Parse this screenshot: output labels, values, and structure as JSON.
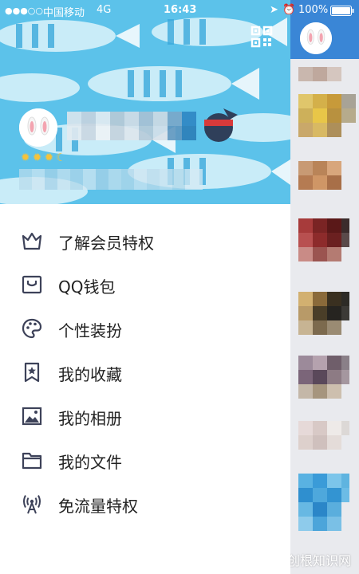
{
  "status_bar": {
    "signal": "●●●○○",
    "carrier": "中国移动",
    "network": "4G",
    "time": "16:43",
    "battery": "100%"
  },
  "header": {
    "qr_icon": "qr-code-icon",
    "avatar_icon": "bunny-avatar",
    "level_icons": [
      "sun-icon",
      "sun-icon",
      "sun-icon",
      "moon-icon"
    ]
  },
  "menu": {
    "items": [
      {
        "label": "了解会员特权",
        "icon": "crown-icon"
      },
      {
        "label": "QQ钱包",
        "icon": "wallet-icon"
      },
      {
        "label": "个性装扮",
        "icon": "palette-icon"
      },
      {
        "label": "我的收藏",
        "icon": "bookmark-star-icon"
      },
      {
        "label": "我的相册",
        "icon": "picture-icon"
      },
      {
        "label": "我的文件",
        "icon": "folder-icon"
      },
      {
        "label": "免流量特权",
        "icon": "signal-tower-icon"
      }
    ]
  },
  "watermark": "爱创根知识网",
  "colors": {
    "header_bg": "#5cc2ea",
    "icon_color": "#3d4259",
    "text_color": "#222222",
    "right_header": "#3a86d6"
  }
}
